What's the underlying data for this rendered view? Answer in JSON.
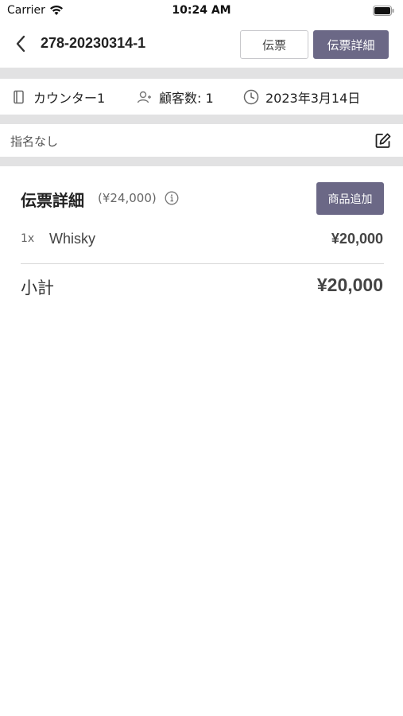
{
  "status_bar": {
    "carrier": "Carrier",
    "time": "10:24 AM"
  },
  "header": {
    "order_number": "278-20230314-1",
    "tabs": [
      {
        "label": "伝票",
        "active": false
      },
      {
        "label": "伝票詳細",
        "active": true
      }
    ]
  },
  "info": {
    "seat": "カウンター1",
    "customers": "顧客数: 1",
    "date": "2023年3月14日"
  },
  "assignment": {
    "text": "指名なし"
  },
  "details": {
    "title": "伝票詳細",
    "total_note": "(¥24,000)",
    "add_button": "商品追加",
    "items": [
      {
        "qty": "1x",
        "name": "Whisky",
        "price": "¥20,000"
      }
    ],
    "subtotal_label": "小計",
    "subtotal_value": "¥20,000"
  },
  "colors": {
    "accent": "#6b6886",
    "band": "#e2e2e3"
  }
}
